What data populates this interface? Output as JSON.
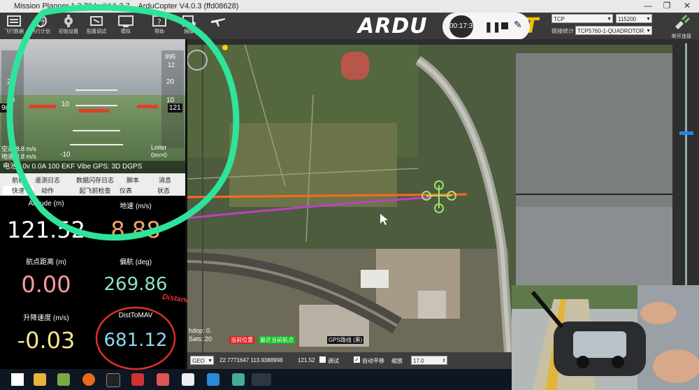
{
  "window": {
    "title": "Mission Planner 1.3.70 build 1.3.7... ArduCopter V4.0.3 (ffd08628)",
    "minimize": "—",
    "restore": "❐",
    "close": "✕"
  },
  "toolbar": {
    "buttons": [
      {
        "label": "飞行数据",
        "icon": "flight-data-icon"
      },
      {
        "label": "飞行计划",
        "icon": "flight-plan-icon"
      },
      {
        "label": "初始设置",
        "icon": "initial-setup-icon"
      },
      {
        "label": "配置调试",
        "icon": "config-tuning-icon"
      },
      {
        "label": "模拟",
        "icon": "simulation-icon"
      },
      {
        "label": "帮助",
        "icon": "help-icon"
      },
      {
        "label": "捐赠",
        "icon": "donate-icon"
      }
    ],
    "logo_text": "ARDU",
    "logo_suffix": "T",
    "connection_type": "TCP",
    "baud": "115200",
    "link_stats_label": "链接统计",
    "vehicle": "TCP5760-1-QUADROTOR",
    "connect_label": "断开连接"
  },
  "recorder": {
    "time": "00:17:31"
  },
  "hud": {
    "ladder_labels": [
      "20",
      "10",
      "10",
      "-10",
      "10",
      "20"
    ],
    "airspeed_label": "空速 8.8 m/s",
    "groundspeed_label": "地速 8.8 m/s",
    "left_value": "9m",
    "right_value": "121",
    "loiter_label": "Loiter",
    "distance_home": "0m>0",
    "top_right": "995",
    "top_value": "12",
    "status_line": "电池0.0v 0.0A  100  EKF  Vibe  GPS: 3D DGPS"
  },
  "tabs": {
    "row1": [
      "航机",
      "遥测日志",
      "数据闪存日志",
      "脚本",
      "消息"
    ],
    "row2": [
      "快速",
      "动作",
      "起飞前检查",
      "仪表",
      "状态"
    ]
  },
  "quick": [
    {
      "label": "Altitude (m)",
      "value": "121.52",
      "color": "#ffffff"
    },
    {
      "label": "地速 (m/s)",
      "value": "8.88",
      "color": "#f5a36a"
    },
    {
      "label": "航点距离 (m)",
      "value": "0.00",
      "color": "#ff9aa0"
    },
    {
      "label": "偏航 (deg)",
      "value": "269.86",
      "color": "#8ee0c4"
    },
    {
      "label": "升降速度 (m/s)",
      "value": "-0.03",
      "color": "#f7e68a"
    },
    {
      "label": "DistToMAV",
      "value": "681.12",
      "color": "#8fd6f0"
    }
  ],
  "annotation": {
    "handwritten": "Distance"
  },
  "map": {
    "hdop": "hdop: 0.",
    "sats": "Sats: 20",
    "legend_a": "当前位置",
    "legend_b": "最近当前航点",
    "legend_c": "GPS路线 (黑)"
  },
  "mapbar": {
    "coord_system": "GEO",
    "coords": "22.7771647 113.9388998",
    "alt": "121.52",
    "debug_label": "调试",
    "auto_pan_label": "自动平移",
    "zoom_label": "缩放",
    "zoom_value": "17.0"
  },
  "colors": {
    "highlight_circle": "#2ee39a",
    "red_circle": "#e0302a",
    "flight_line": "#ff6a1a",
    "track_line": "#c040c0"
  }
}
